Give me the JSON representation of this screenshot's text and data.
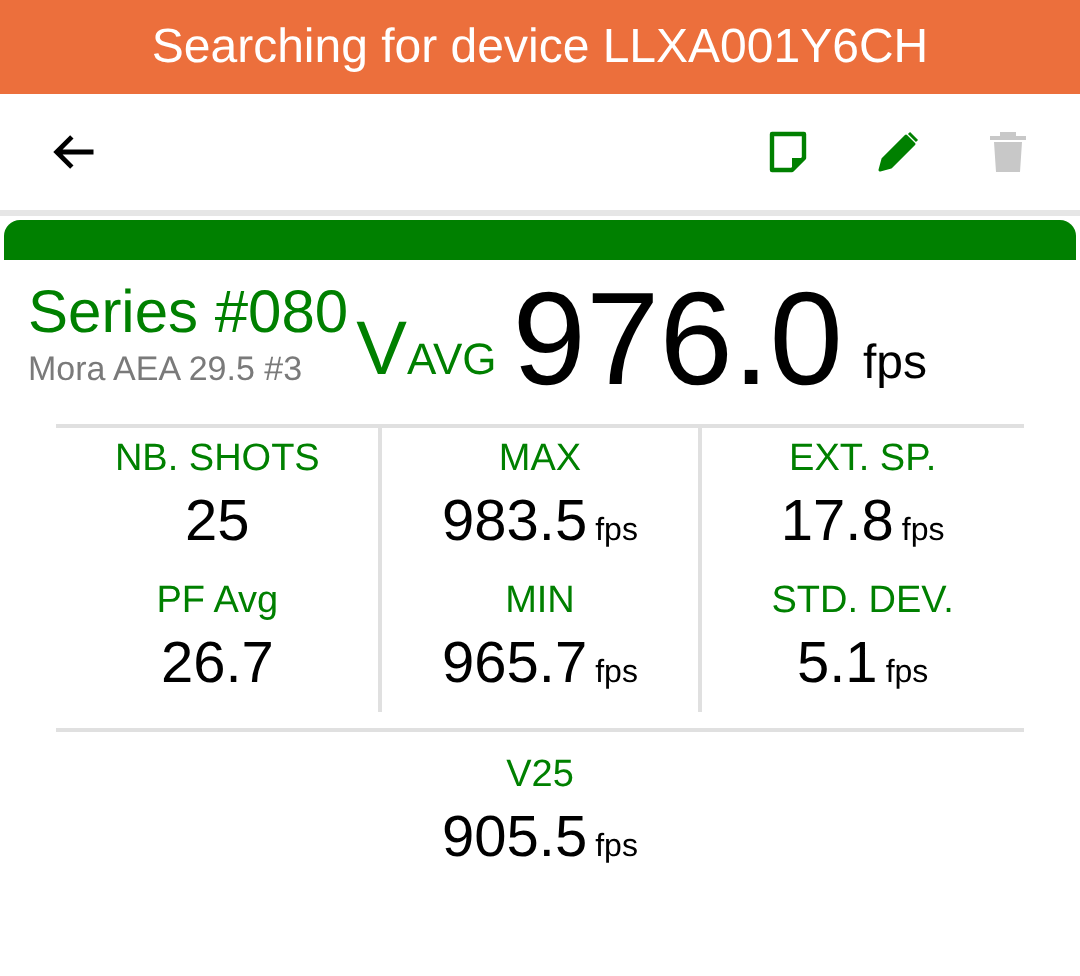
{
  "banner": {
    "text": "Searching for device LLXA001Y6CH"
  },
  "toolbar": {
    "actions": [
      {
        "kind": "note",
        "disabled": false
      },
      {
        "kind": "edit",
        "disabled": false
      },
      {
        "kind": "delete",
        "disabled": true
      }
    ]
  },
  "series": {
    "title": "Series #080",
    "subtitle": "Mora AEA 29.5 #3",
    "average_label": "V$_{AVG}$",
    "average_value": "976.0",
    "average_unit": "fps"
  },
  "stats": [
    {
      "label": "NB. SHOTS",
      "value": "25"
    },
    {
      "label": "MAX",
      "value": "983.5",
      "unit": "fps"
    },
    {
      "label": "EXT. SP.",
      "value": "17.8",
      "unit": "fps"
    },
    {
      "label": "PF Avg",
      "value": "26.7"
    },
    {
      "label": "MIN",
      "value": "965.7",
      "unit": "fps"
    },
    {
      "label": "STD. DEV.",
      "value": "5.1",
      "unit": "fps"
    }
  ],
  "extra": {
    "label": "V25",
    "value": "905.5",
    "unit": "fps"
  }
}
